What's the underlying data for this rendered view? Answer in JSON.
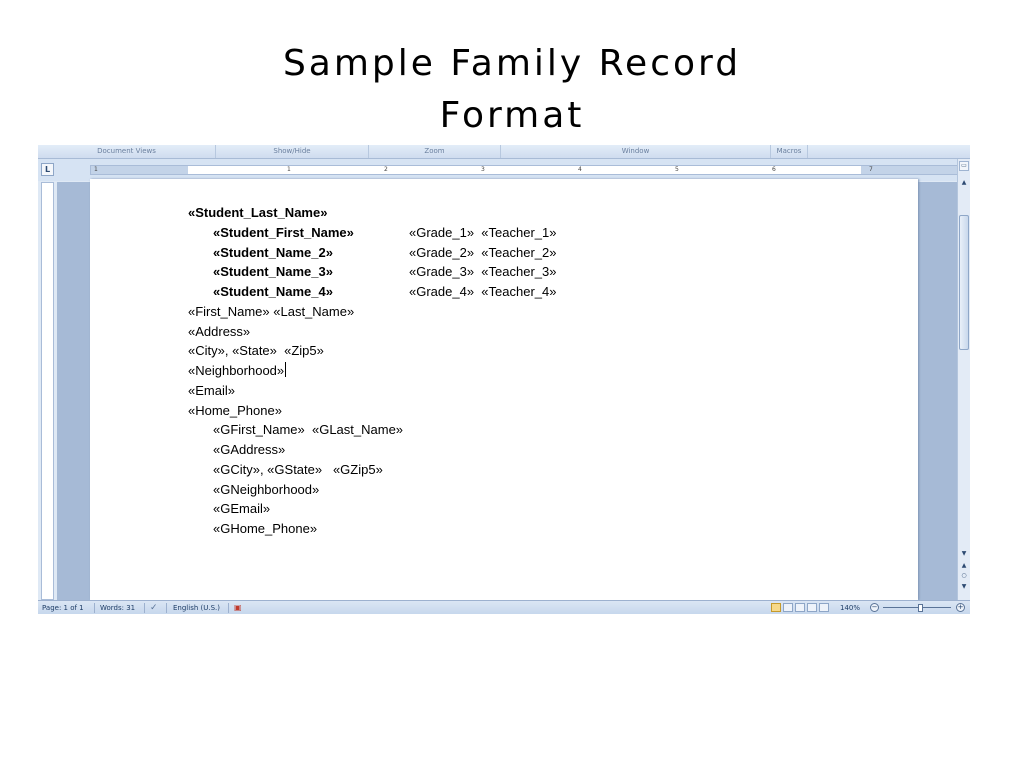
{
  "slide": {
    "title_line1": "Sample Family Record",
    "title_line2": "Format"
  },
  "ribbon": {
    "groups": [
      "Document Views",
      "Show/Hide",
      "Zoom",
      "Window",
      "Macros"
    ]
  },
  "ruler": {
    "ticks": [
      "1",
      "1",
      "2",
      "3",
      "4",
      "5",
      "6",
      "7"
    ],
    "tab_button": "L"
  },
  "document": {
    "student_last_name": "«Student_Last_Name»",
    "students": [
      {
        "name": "«Student_First_Name»",
        "grade": "«Grade_1»",
        "teacher": "«Teacher_1»"
      },
      {
        "name": "«Student_Name_2»",
        "grade": "«Grade_2»",
        "teacher": "«Teacher_2»"
      },
      {
        "name": "«Student_Name_3»",
        "grade": "«Grade_3»",
        "teacher": "«Teacher_3»"
      },
      {
        "name": "«Student_Name_4»",
        "grade": "«Grade_4»",
        "teacher": "«Teacher_4»"
      }
    ],
    "parent": {
      "name_line": "«First_Name» «Last_Name»",
      "address": "«Address»",
      "city_line": "«City», «State»  «Zip5»",
      "neighborhood": "«Neighborhood»",
      "email": "«Email»",
      "home_phone": "«Home_Phone»"
    },
    "guardian": {
      "name_line": "«GFirst_Name»  «GLast_Name»",
      "address": "«GAddress»",
      "city_line": "«GCity», «GState»   «GZip5»",
      "neighborhood": "«GNeighborhood»",
      "email": "«GEmail»",
      "home_phone": "«GHome_Phone»"
    }
  },
  "statusbar": {
    "page": "Page: 1 of 1",
    "words": "Words: 31",
    "language": "English (U.S.)",
    "zoom": "140%",
    "zoom_minus": "−",
    "zoom_plus": "+"
  },
  "icons": {
    "scroll_up": "▲",
    "scroll_down": "▼",
    "prev_page": "▲",
    "browse_object": "○",
    "next_page": "▼",
    "ruler_toggle": "▭",
    "proofing": "✓",
    "macro": "▣"
  }
}
